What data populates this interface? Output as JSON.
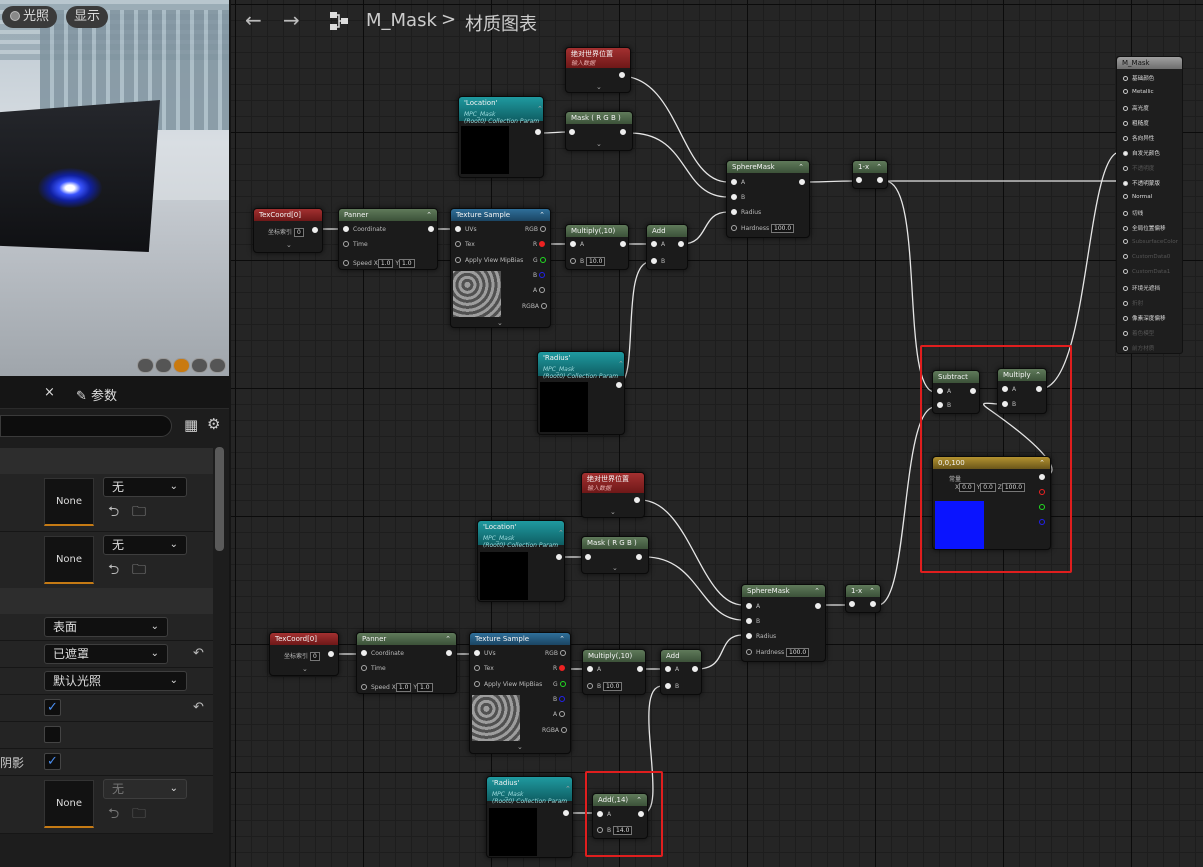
{
  "viewport": {
    "lit_label": "光照",
    "show_label": "显示"
  },
  "details": {
    "tab_close": "×",
    "tab_params": "参数",
    "none_label": "None",
    "none_combo": "无",
    "blend_mode": "表面",
    "shading": "已遮罩",
    "lighting": "默认光照",
    "shadow_suffix": "阴影",
    "disabled_combo": "无"
  },
  "toolbar": {
    "back": "←",
    "forward": "→",
    "title": "M_Mask",
    "sep": ">",
    "subtitle": "材质图表"
  },
  "nodes": {
    "abs_world_pos": "绝对世界位置",
    "input_data": "输入数据",
    "location": "'Location'",
    "radius": "'Radius'",
    "mpc": "MPC_Mask",
    "mpc_param": "(Root0) Collection Param",
    "mask_rgb": "Mask ( R G B )",
    "texcoord": "TexCoord[0]",
    "coord_index": "坐标索引",
    "coord_value": "0",
    "panner": "Panner",
    "coordinate": "Coordinate",
    "time": "Time",
    "speed": "Speed",
    "x": "X",
    "y": "Y",
    "speed_value": "1.0",
    "texture_sample": "Texture Sample",
    "uvs": "UVs",
    "tex": "Tex",
    "apply_mip": "Apply View MipBias",
    "r": "R",
    "g": "G",
    "b": "B",
    "a": "A",
    "rgba": "RGBA",
    "rgb": "RGB",
    "multiply10": "Multiply(,10)",
    "mul_b": "10.0",
    "add": "Add",
    "spheremask": "SphereMask",
    "radius_pin": "Radius",
    "hardness": "Hardness",
    "hardness_value": "100.0",
    "one_minus": "1-x",
    "subtract": "Subtract",
    "multiply": "Multiply",
    "const_title": "0,0,100",
    "const_default": "常量",
    "z": "Z",
    "cx": "0.0",
    "cy": "0.0",
    "cz": "100.0",
    "add14": "Add(,14)",
    "add14_b": "14.0"
  },
  "material": {
    "title": "M_Mask",
    "pins": [
      {
        "label": "基础颜色",
        "active": true
      },
      {
        "label": "Metallic",
        "active": true
      },
      {
        "label": "高光度",
        "active": true
      },
      {
        "label": "粗糙度",
        "active": true
      },
      {
        "label": "各向异性",
        "active": true
      },
      {
        "label": "自发光颜色",
        "active": true
      },
      {
        "label": "不透明度",
        "active": false
      },
      {
        "label": "不透明蒙版",
        "active": true
      },
      {
        "label": "Normal",
        "active": true
      },
      {
        "label": "切线",
        "active": true
      },
      {
        "label": "全局位置偏移",
        "active": true
      },
      {
        "label": "SubsurfaceColor",
        "active": false
      },
      {
        "label": "CustomData0",
        "active": false
      },
      {
        "label": "CustomData1",
        "active": false
      },
      {
        "label": "环境光遮挡",
        "active": true
      },
      {
        "label": "折射",
        "active": false
      },
      {
        "label": "像素深度偏移",
        "active": true
      },
      {
        "label": "着色模型",
        "active": false
      },
      {
        "label": "前方材质",
        "active": false
      }
    ]
  },
  "colors": {
    "highlight": "#e01e1e",
    "wire": "#e6e6e6",
    "accent_orange": "#c57a14",
    "const_blue": "#0a14ff"
  }
}
